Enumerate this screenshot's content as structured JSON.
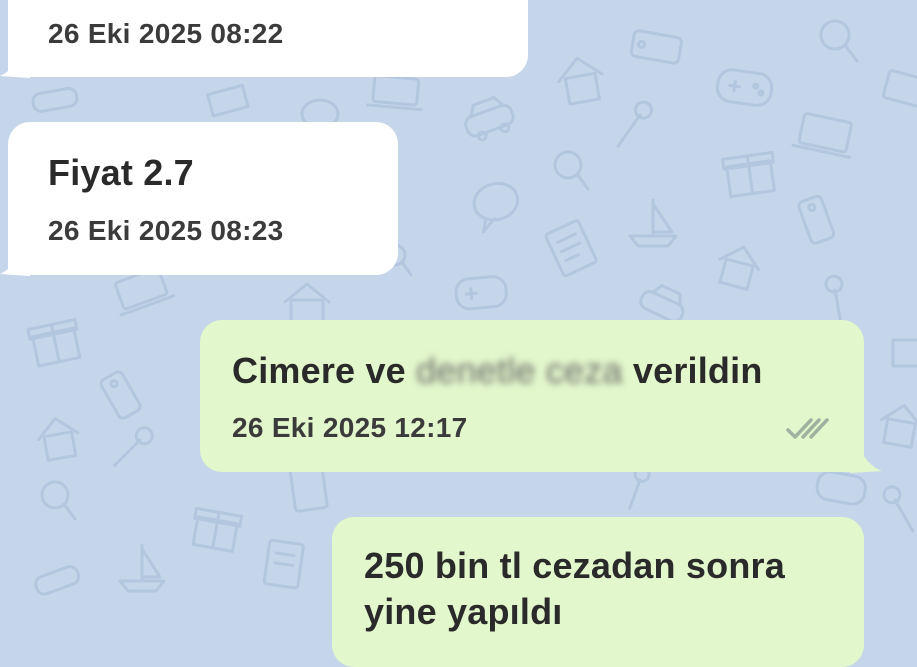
{
  "chat": {
    "messages": [
      {
        "direction": "incoming",
        "text": "",
        "time": "26 Eki 2025 08:22"
      },
      {
        "direction": "incoming",
        "text": "Fiyat 2.7",
        "time": "26 Eki 2025 08:23"
      },
      {
        "direction": "outgoing",
        "text_before": "Cimere ve ",
        "text_redacted": "denetle ceza",
        "text_after": " verildin",
        "time": "26 Eki 2025 12:17",
        "status_icon": "double-check-icon"
      },
      {
        "direction": "outgoing",
        "text": "250 bin tl cezadan sonra",
        "text_line2": "yine yapıldı"
      }
    ]
  },
  "colors": {
    "background": "#c6d6ea",
    "incoming_bubble": "#ffffff",
    "outgoing_bubble": "#e2f7cb",
    "check_marks": "#9fb2a0"
  }
}
